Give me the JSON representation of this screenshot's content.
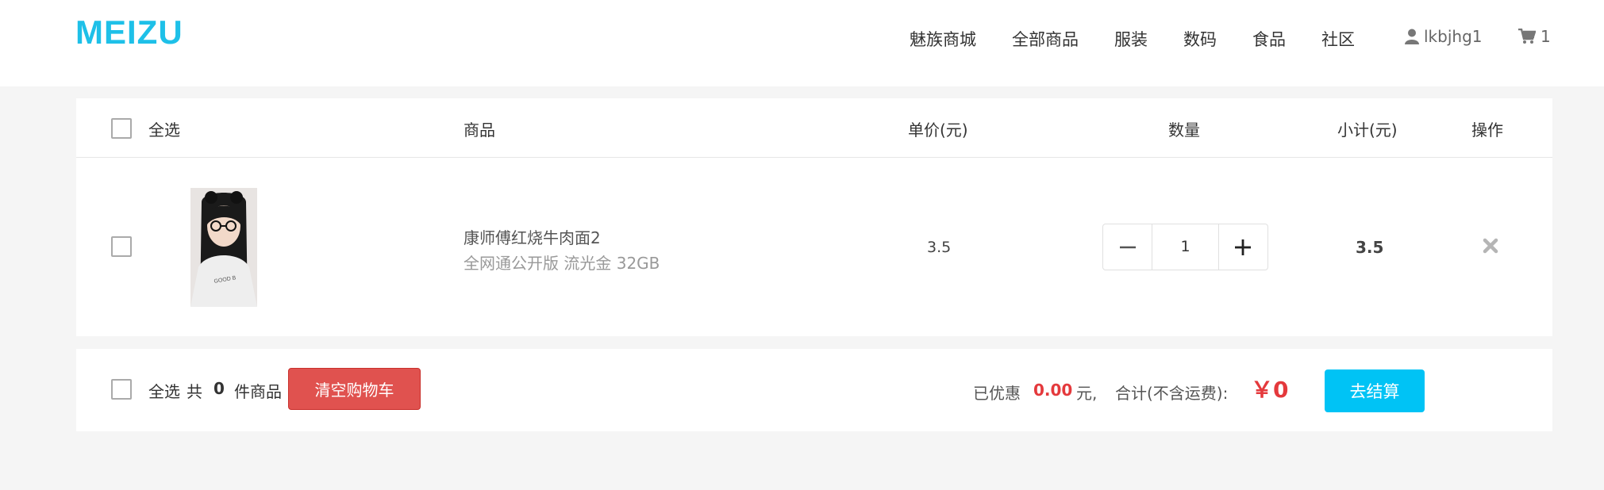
{
  "header": {
    "logo_text": "MEIZU",
    "brand_color": "#1ec0e8",
    "nav": [
      "魅族商城",
      "全部商品",
      "服装",
      "数码",
      "食品",
      "社区"
    ],
    "username": "lkbjhg1",
    "cart_count": "1"
  },
  "table": {
    "headers": {
      "select_all": "全选",
      "product": "商品",
      "unit_price": "单价(元)",
      "quantity": "数量",
      "subtotal": "小计(元)",
      "action": "操作"
    },
    "items": [
      {
        "name": "康师傅红烧牛肉面2",
        "spec": "全网通公开版 流光金 32GB",
        "price": "3.5",
        "quantity": "1",
        "subtotal": "3.5"
      }
    ]
  },
  "footer": {
    "select_all": "全选",
    "count_prefix": "共",
    "count": "0",
    "count_suffix": "件商品",
    "clear_button": "清空购物车",
    "discount_label": "已优惠",
    "discount_value": "0.00",
    "discount_unit": "元,",
    "total_label": "合计(不含运费):",
    "total_value": "￥0",
    "checkout_button": "去结算"
  },
  "colors": {
    "accent": "#00c3f5",
    "danger": "#e0524f",
    "price_red": "#e4393c"
  }
}
